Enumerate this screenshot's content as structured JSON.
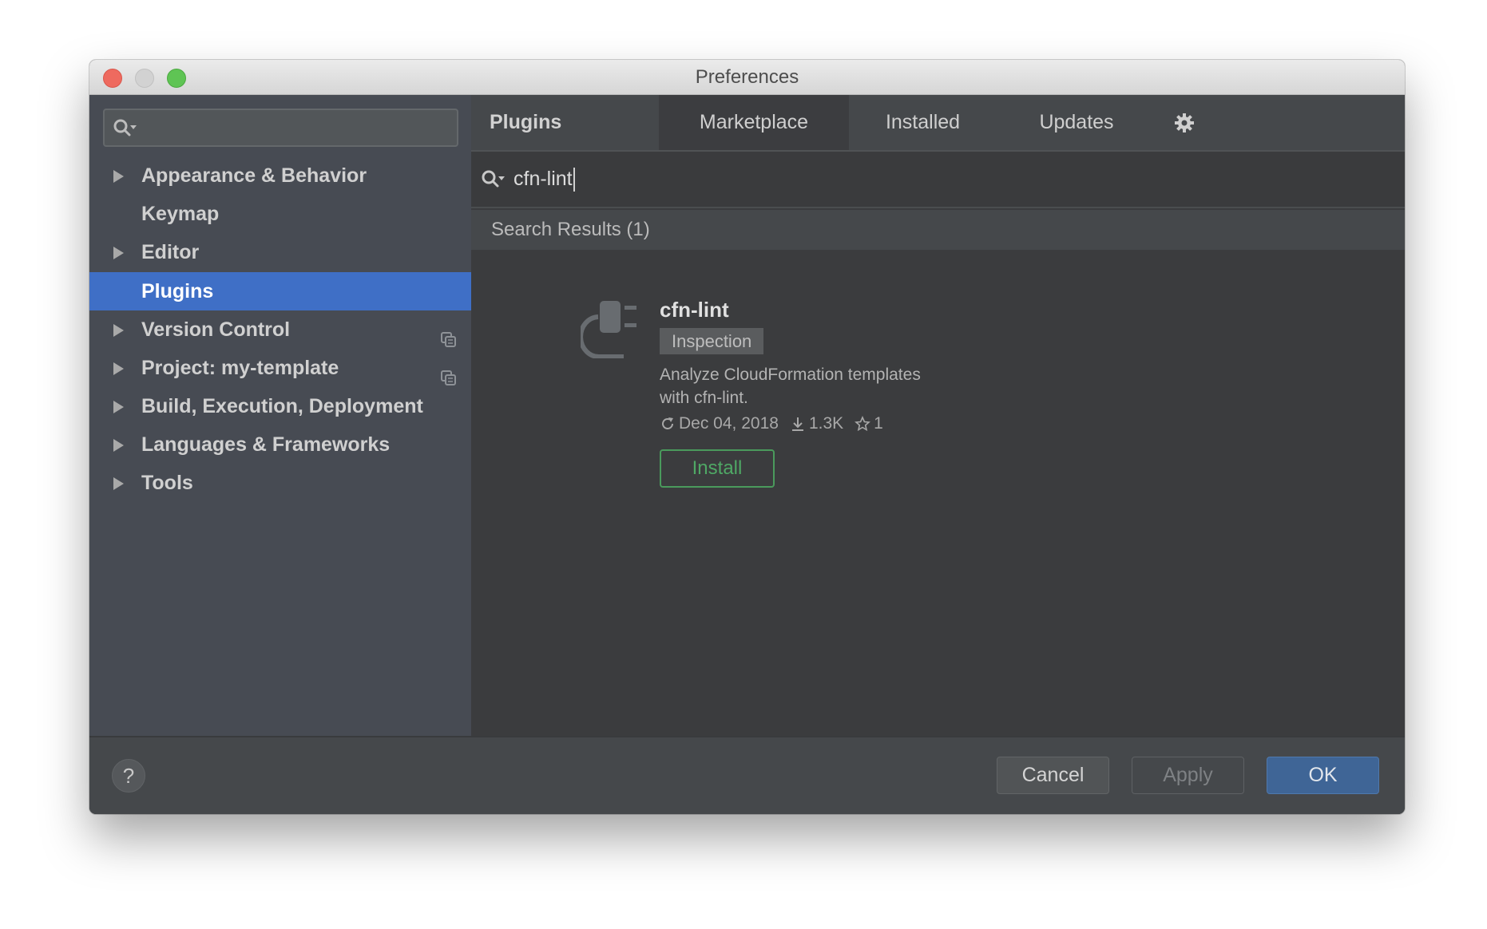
{
  "window": {
    "title": "Preferences",
    "controls": [
      "close",
      "minimize",
      "maximize"
    ]
  },
  "sidebar": {
    "search": {
      "value": "",
      "placeholder": ""
    },
    "items": [
      {
        "label": "Appearance & Behavior",
        "expandable": true,
        "selected": false,
        "project_level": false
      },
      {
        "label": "Keymap",
        "expandable": false,
        "selected": false,
        "project_level": false
      },
      {
        "label": "Editor",
        "expandable": true,
        "selected": false,
        "project_level": false
      },
      {
        "label": "Plugins",
        "expandable": false,
        "selected": true,
        "project_level": false
      },
      {
        "label": "Version Control",
        "expandable": true,
        "selected": false,
        "project_level": true
      },
      {
        "label": "Project: my-template",
        "expandable": true,
        "selected": false,
        "project_level": true
      },
      {
        "label": "Build, Execution, Deployment",
        "expandable": true,
        "selected": false,
        "project_level": false
      },
      {
        "label": "Languages & Frameworks",
        "expandable": true,
        "selected": false,
        "project_level": false
      },
      {
        "label": "Tools",
        "expandable": true,
        "selected": false,
        "project_level": false
      }
    ]
  },
  "plugins": {
    "heading": "Plugins",
    "tabs": [
      {
        "label": "Marketplace",
        "selected": true
      },
      {
        "label": "Installed",
        "selected": false
      },
      {
        "label": "Updates",
        "selected": false
      }
    ],
    "settings_icon": "gear-icon",
    "search": {
      "value": "cfn-lint"
    },
    "results_header": "Search Results (1)",
    "results": [
      {
        "name": "cfn-lint",
        "tag": "Inspection",
        "description": "Analyze CloudFormation templates with cfn-lint.",
        "updated": "Dec 04, 2018",
        "downloads": "1.3K",
        "rating": "1",
        "action": "Install"
      }
    ]
  },
  "footer": {
    "help_label": "?",
    "cancel_label": "Cancel",
    "apply_label": "Apply",
    "ok_label": "OK"
  },
  "colors": {
    "selection": "#3f6fc6",
    "install_green": "#4fa865",
    "ok_blue": "#3f6596"
  }
}
